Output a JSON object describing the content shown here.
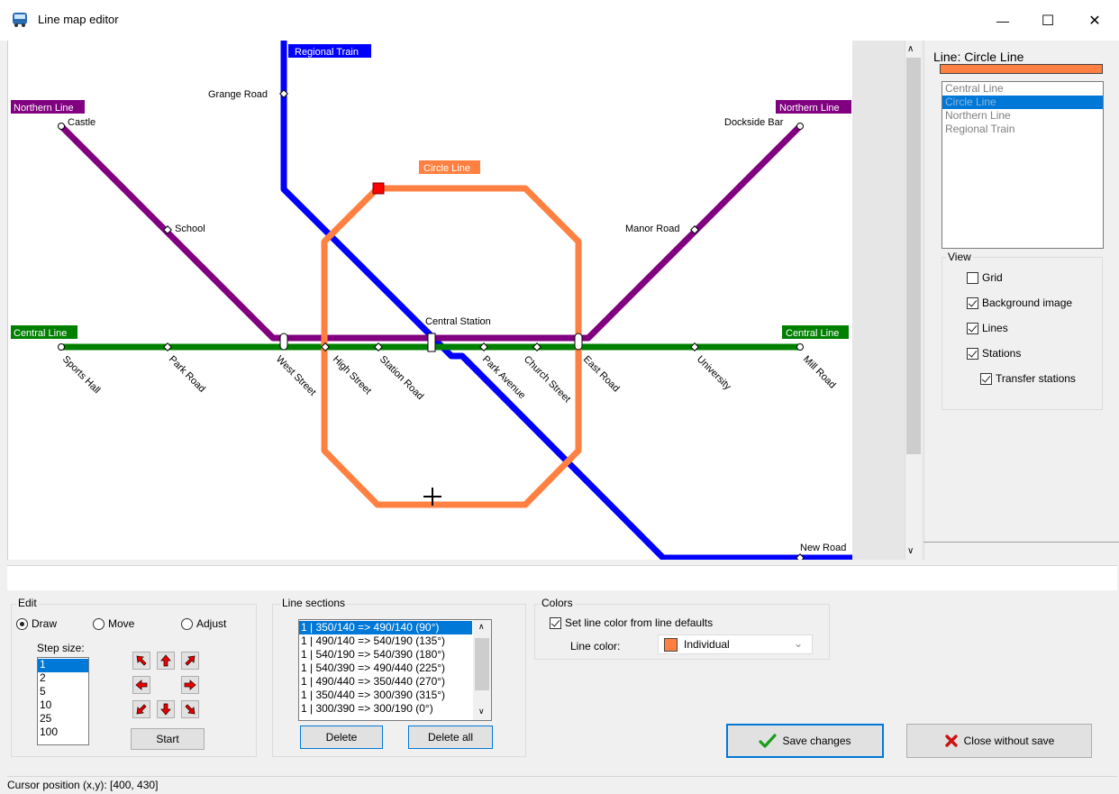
{
  "window": {
    "title": "Line map editor",
    "minimize_glyph": "—",
    "maximize_glyph": "☐",
    "close_glyph": "✕"
  },
  "map": {
    "lines": [
      {
        "name": "Regional Train",
        "color": "#0000ff"
      },
      {
        "name": "Northern Line",
        "color": "#800080"
      },
      {
        "name": "Circle Line",
        "color": "#ff8040"
      },
      {
        "name": "Central Line",
        "color": "#008000"
      }
    ],
    "line_labels": {
      "regional_train": "Regional Train",
      "northern_left": "Northern Line",
      "northern_right": "Northern Line",
      "circle": "Circle Line",
      "central_left": "Central Line",
      "central_right": "Central Line"
    },
    "stations": {
      "grange_road": "Grange Road",
      "castle": "Castle",
      "dockside_bar": "Dockside Bar",
      "school": "School",
      "manor_road": "Manor Road",
      "central_station": "Central Station",
      "new_road": "New Road",
      "sports_hall": "Sports Hall",
      "park_road": "Park Road",
      "west_street": "West Street",
      "high_street": "High Street",
      "station_road": "Station Road",
      "park_avenue": "Park Avenue",
      "church_street": "Church Street",
      "east_road": "East Road",
      "university": "University",
      "mill_road": "Mill Road"
    }
  },
  "right_panel": {
    "line_title": "Line: Circle Line",
    "line_color": "#ff8040",
    "line_list": [
      "Central Line",
      "Circle Line",
      "Northern Line",
      "Regional Train"
    ],
    "selected_line_index": 1,
    "view": {
      "legend": "View",
      "grid": {
        "label": "Grid",
        "checked": false
      },
      "background_image": {
        "label": "Background image",
        "checked": true
      },
      "lines": {
        "label": "Lines",
        "checked": true
      },
      "stations": {
        "label": "Stations",
        "checked": true
      },
      "transfer_stations": {
        "label": "Transfer stations",
        "checked": true
      }
    }
  },
  "edit": {
    "legend": "Edit",
    "modes": [
      {
        "label": "Draw",
        "selected": true
      },
      {
        "label": "Move",
        "selected": false
      },
      {
        "label": "Adjust",
        "selected": false
      }
    ],
    "step_size_label": "Step size:",
    "step_sizes": [
      "1",
      "2",
      "5",
      "10",
      "25",
      "100"
    ],
    "selected_step": "1",
    "start_label": "Start"
  },
  "line_sections": {
    "legend": "Line sections",
    "items": [
      "1 | 350/140 => 490/140 (90°)",
      "1 | 490/140 => 540/190 (135°)",
      "1 | 540/190 => 540/390 (180°)",
      "1 | 540/390 => 490/440 (225°)",
      "1 | 490/440 => 350/440 (270°)",
      "1 | 350/440 => 300/390 (315°)",
      "1 | 300/390 => 300/190 (0°)"
    ],
    "delete_label": "Delete",
    "delete_all_label": "Delete all"
  },
  "colors": {
    "legend": "Colors",
    "set_from_defaults": {
      "label": "Set line color from line defaults",
      "checked": true
    },
    "line_color_label": "Line color:",
    "line_color_value": "Individual",
    "swatch": "#ff8040"
  },
  "actions": {
    "save_label": "Save changes",
    "close_label": "Close without save"
  },
  "status": {
    "cursor_position": "Cursor position (x,y): [400, 430]"
  }
}
